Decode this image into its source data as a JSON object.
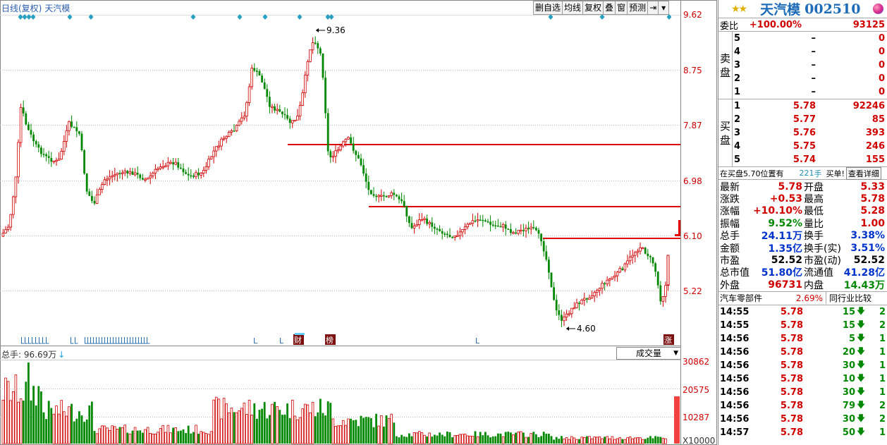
{
  "chart": {
    "type_label": "日线(复权)",
    "stock_name": "天汽模",
    "toolbar": [
      "删自选",
      "均线",
      "复权",
      "叠",
      "窗",
      "预测"
    ],
    "price_axis": [
      "9.62",
      "8.75",
      "7.87",
      "6.98",
      "6.10",
      "5.22"
    ],
    "annotations": {
      "high": "9.36",
      "low": "4.60"
    },
    "markers": [
      "L",
      "L",
      "L",
      "L",
      "L",
      "L",
      "L"
    ],
    "badges": {
      "cai": "财",
      "bang": "榜",
      "zhang": "涨"
    },
    "volume": {
      "title_prefix": "总手: ",
      "title_value": "96.69万",
      "select_label": "成交量",
      "axis": [
        "30862",
        "20575",
        "10287",
        "X10000"
      ]
    },
    "colors": {
      "up": "#d00000",
      "down": "#008800",
      "support": "#dd0000",
      "diamond": "#2aa0c0"
    }
  },
  "quote": {
    "name": "天汽模",
    "code": "002510",
    "weibi": {
      "label": "委比",
      "pct": "+100.00%",
      "diff": "93125"
    },
    "sell_label": "卖盘",
    "buy_label": "买盘",
    "sell": [
      {
        "lv": "5",
        "price": "–",
        "qty": "0"
      },
      {
        "lv": "4",
        "price": "–",
        "qty": "0"
      },
      {
        "lv": "3",
        "price": "–",
        "qty": "0"
      },
      {
        "lv": "2",
        "price": "–",
        "qty": "0"
      },
      {
        "lv": "1",
        "price": "–",
        "qty": "0"
      }
    ],
    "buy": [
      {
        "lv": "1",
        "price": "5.78",
        "qty": "92246"
      },
      {
        "lv": "2",
        "price": "5.77",
        "qty": "85"
      },
      {
        "lv": "3",
        "price": "5.76",
        "qty": "393"
      },
      {
        "lv": "4",
        "price": "5.75",
        "qty": "246"
      },
      {
        "lv": "5",
        "price": "5.74",
        "qty": "155"
      }
    ],
    "buyhint": {
      "text": "在买盘5.70位置有",
      "num": "221",
      "unit": "手",
      "link": "买单!",
      "btn": "查看详细"
    },
    "stats": [
      {
        "k1": "最新",
        "v1": "5.78",
        "c1": "red",
        "k2": "开盘",
        "v2": "5.33",
        "c2": "red"
      },
      {
        "k1": "涨跌",
        "v1": "+0.53",
        "c1": "red",
        "k2": "最高",
        "v2": "5.78",
        "c2": "red"
      },
      {
        "k1": "涨幅",
        "v1": "+10.10%",
        "c1": "red",
        "k2": "最低",
        "v2": "5.28",
        "c2": "red"
      },
      {
        "k1": "振幅",
        "v1": "9.52%",
        "c1": "green",
        "k2": "量比",
        "v2": "1.00",
        "c2": "red"
      },
      {
        "k1": "总手",
        "v1": "24.11万",
        "c1": "blue",
        "k2": "换手",
        "v2": "3.38%",
        "c2": "blue"
      },
      {
        "k1": "金额",
        "v1": "1.35亿",
        "c1": "blue",
        "k2": "换手(实)",
        "v2": "3.51%",
        "c2": "blue"
      },
      {
        "k1": "市盈",
        "v1": "52.52",
        "c1": "black",
        "k2": "市盈(动)",
        "v2": "52.52",
        "c2": "black"
      },
      {
        "k1": "总市值",
        "v1": "51.80亿",
        "c1": "blue",
        "k2": "流通值",
        "v2": "41.28亿",
        "c2": "blue"
      },
      {
        "k1": "外盘",
        "v1": "96731",
        "c1": "red",
        "k2": "内盘",
        "v2": "14.43万",
        "c2": "green"
      }
    ],
    "sector": {
      "name": "汽车零部件",
      "pct": "2.69%",
      "btn": "同行业比较"
    },
    "ticks": [
      {
        "time": "14:55",
        "price": "5.78",
        "vol": "15",
        "num": "2"
      },
      {
        "time": "14:55",
        "price": "5.78",
        "vol": "15",
        "num": "2"
      },
      {
        "time": "14:56",
        "price": "5.78",
        "vol": "5",
        "num": "1"
      },
      {
        "time": "14:56",
        "price": "5.78",
        "vol": "20",
        "num": "1"
      },
      {
        "time": "14:56",
        "price": "5.78",
        "vol": "30",
        "num": "1"
      },
      {
        "time": "14:56",
        "price": "5.78",
        "vol": "10",
        "num": "1"
      },
      {
        "time": "14:56",
        "price": "5.78",
        "vol": "30",
        "num": "1"
      },
      {
        "time": "14:56",
        "price": "5.78",
        "vol": "79",
        "num": "2"
      },
      {
        "time": "14:56",
        "price": "5.78",
        "vol": "30",
        "num": "2"
      },
      {
        "time": "14:57",
        "price": "5.78",
        "vol": "50",
        "num": "1"
      }
    ]
  }
}
